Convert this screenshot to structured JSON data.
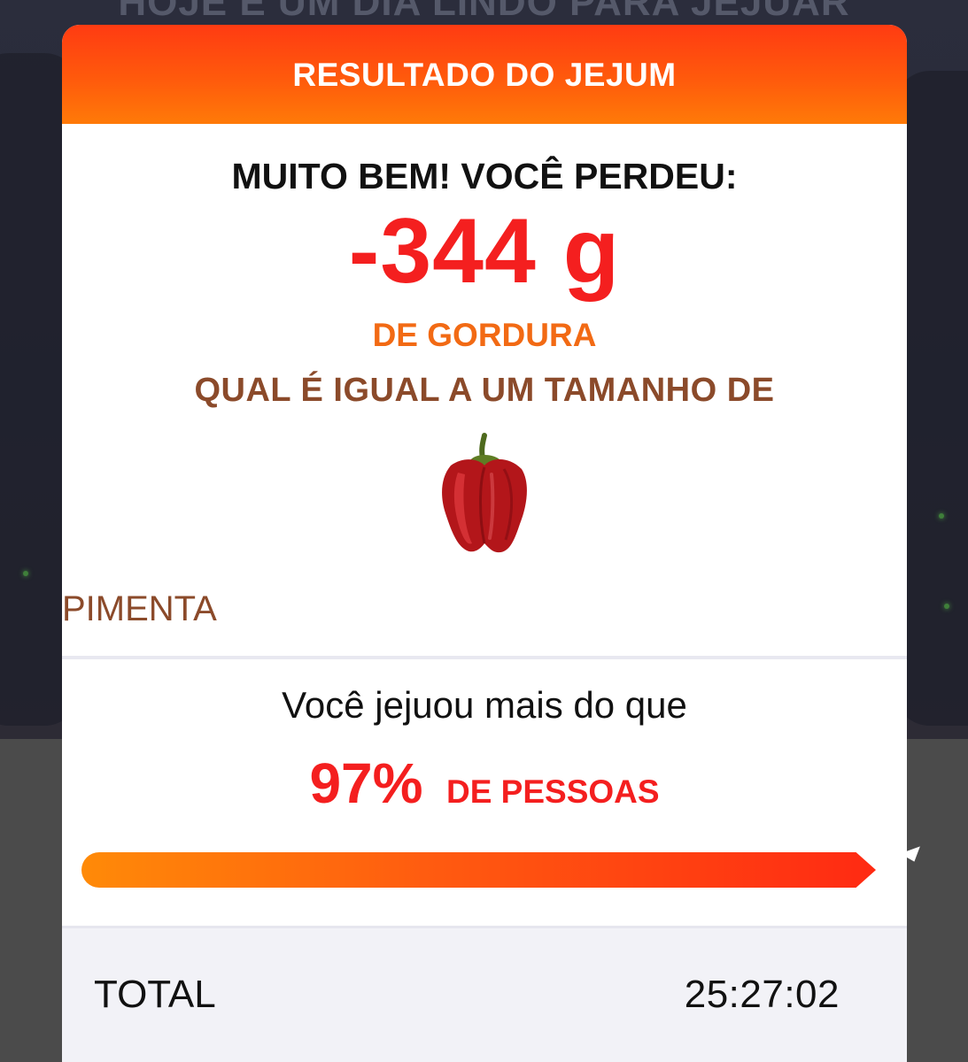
{
  "background": {
    "headline": "HOJE É UM DIA LINDO PARA JEJUAR"
  },
  "modal": {
    "title": "RESULTADO DO JEJUM",
    "result": {
      "subtitle": "MUITO BEM! VOCÊ PERDEU:",
      "amount": "-344 g",
      "unit_label": "DE GORDURA",
      "compare_text": "QUAL É IGUAL A UM TAMANHO DE",
      "food_icon": "red-bell-pepper-icon",
      "food_name": "PIMENTA"
    },
    "ranking": {
      "label": "Você jejuou mais do que",
      "percent": "97%",
      "percent_label": "DE PESSOAS",
      "progress_fraction": 0.97
    },
    "total": {
      "label": "TOTAL",
      "value": "25:27:02"
    }
  },
  "colors": {
    "header_gradient_start": "#ff3b12",
    "header_gradient_end": "#ff7a08",
    "accent_red": "#f41f1f",
    "accent_orange": "#f26a14",
    "brown_text": "#8b4a2a"
  }
}
